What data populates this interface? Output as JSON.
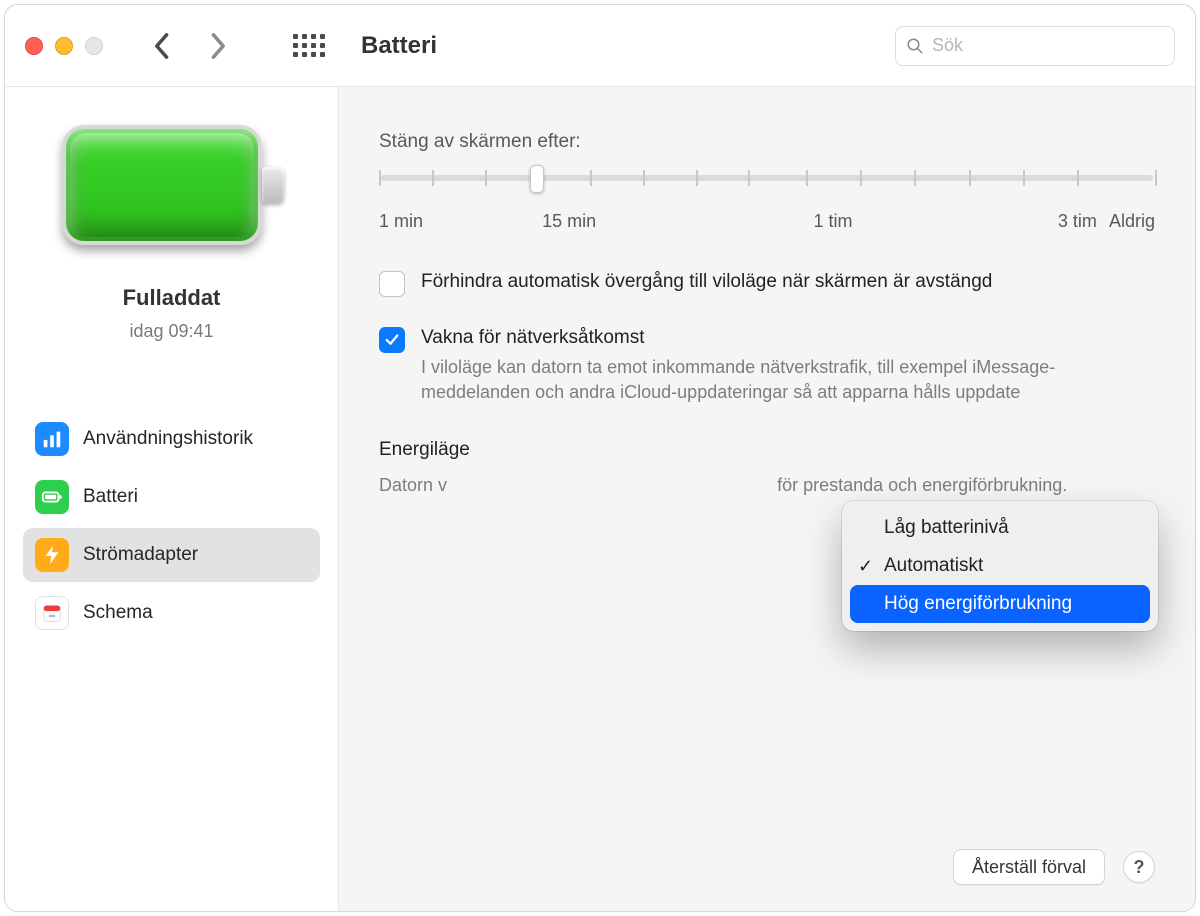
{
  "toolbar": {
    "title": "Batteri",
    "search_placeholder": "Sök"
  },
  "sidebar": {
    "status_title": "Fulladdat",
    "status_time": "idag 09:41",
    "items": [
      {
        "label": "Användningshistorik"
      },
      {
        "label": "Batteri"
      },
      {
        "label": "Strömadapter"
      },
      {
        "label": "Schema"
      }
    ],
    "selected_index": 2
  },
  "content": {
    "display_off_label": "Stäng av skärmen efter:",
    "slider": {
      "ticks_pct": [
        0,
        6.8,
        13.6,
        20.4,
        27.2,
        34.0,
        40.8,
        47.6,
        55.0,
        62.0,
        69.0,
        76.0,
        83.0,
        90.0,
        100.0
      ],
      "thumb_pct": 20.4,
      "labels": [
        {
          "text": "1 min",
          "pct": 0,
          "align": "left"
        },
        {
          "text": "15 min",
          "pct": 24.5,
          "align": "center"
        },
        {
          "text": "1 tim",
          "pct": 58.5,
          "align": "center"
        },
        {
          "text": "3 tim",
          "pct": 90.0,
          "align": "center"
        },
        {
          "text": "Aldrig",
          "pct": 100.0,
          "align": "right"
        }
      ]
    },
    "prevent_sleep": {
      "checked": false,
      "label": "Förhindra automatisk övergång till viloläge när skärmen är avstängd"
    },
    "wake_network": {
      "checked": true,
      "label": "Vakna för nätverksåtkomst",
      "desc_prefix": "I viloläge kan datorn ta emot inkommande nätverkstrafik, till exempel iMessage-meddelanden och andra iCloud-uppdateringar så att apparna hålls uppdate"
    },
    "energy_mode": {
      "label_prefix": "Energiläge",
      "desc_prefix": "Datorn v",
      "desc_suffix": "för prestanda och energiförbrukning.",
      "options": [
        {
          "label": "Låg batterinivå",
          "checked": false
        },
        {
          "label": "Automatiskt",
          "checked": true
        },
        {
          "label": "Hög energiförbrukning",
          "checked": false
        }
      ],
      "highlight_index": 2
    },
    "reset_button": "Återställ förval"
  }
}
